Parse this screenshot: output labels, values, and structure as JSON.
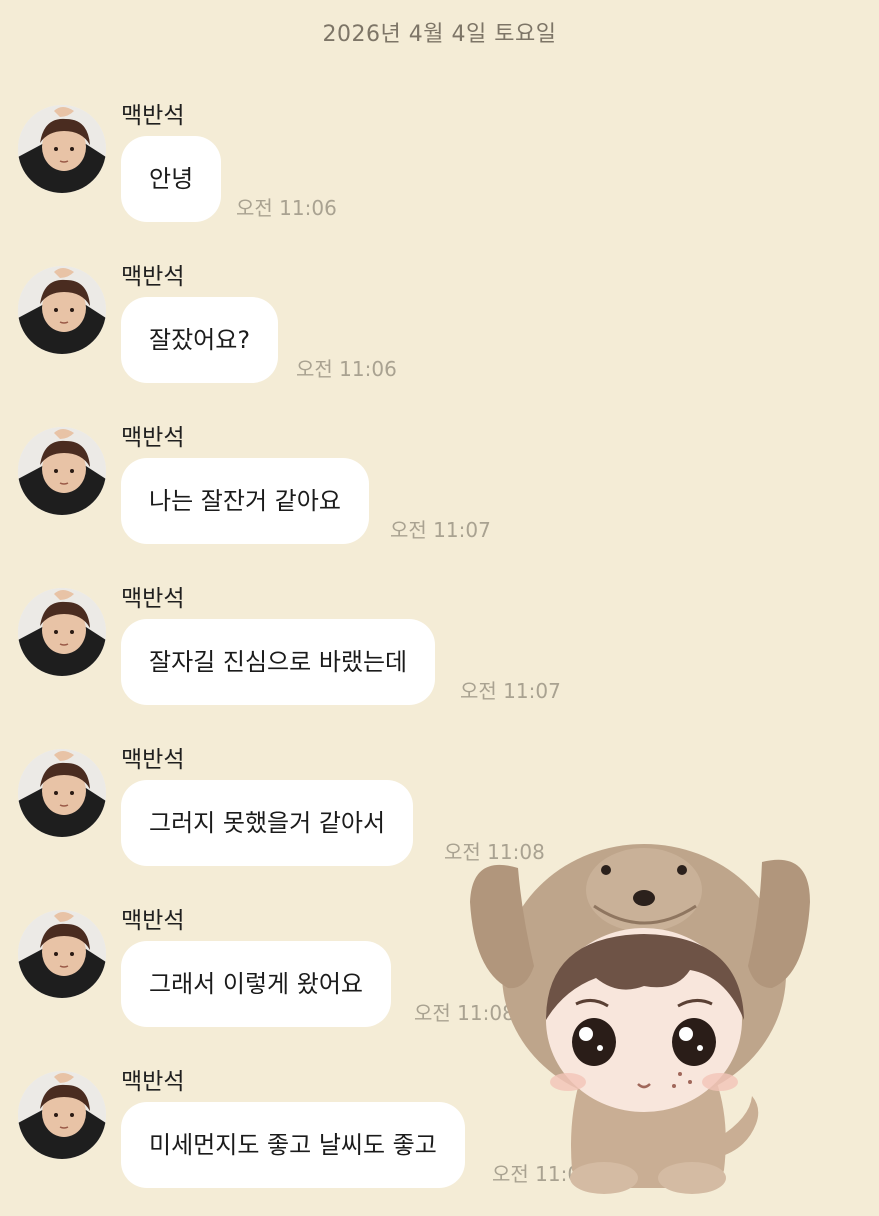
{
  "chat": {
    "date": "2026년 4월 4일 토요일",
    "messages": [
      {
        "sender": "맥반석",
        "text": "안녕",
        "time": "오전 11:06"
      },
      {
        "sender": "맥반석",
        "text": "잘잤어요?",
        "time": "오전 11:06"
      },
      {
        "sender": "맥반석",
        "text": "나는 잘잔거 같아요",
        "time": "오전 11:07"
      },
      {
        "sender": "맥반석",
        "text": "잘자길 진심으로 바랬는데",
        "time": "오전 11:07"
      },
      {
        "sender": "맥반석",
        "text": "그러지 못했을거 같아서",
        "time": "오전 11:08"
      },
      {
        "sender": "맥반석",
        "text": "그래서 이렇게 왔어요",
        "time": "오전 11:08"
      },
      {
        "sender": "맥반석",
        "text": "미세먼지도 좋고 날씨도 좋고",
        "time": "오전 11:08"
      }
    ]
  },
  "colors": {
    "background": "#f4ecd6",
    "bubble": "#ffffff",
    "time_text": "#a9a291",
    "date_text": "#7d7567"
  },
  "icons": {
    "avatar": "profile-photo",
    "sticker": "puppy-costume-character-sticker"
  }
}
